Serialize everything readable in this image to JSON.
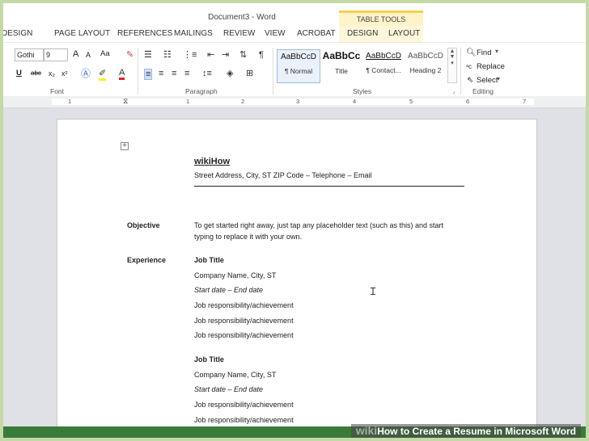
{
  "window": {
    "doc_title": "Document3 - Word",
    "contextual_group": "TABLE TOOLS"
  },
  "tabs": [
    "DESIGN",
    "PAGE LAYOUT",
    "REFERENCES",
    "MAILINGS",
    "REVIEW",
    "VIEW",
    "ACROBAT",
    "DESIGN",
    "LAYOUT"
  ],
  "ribbon": {
    "font": {
      "group_label": "Font",
      "font_name": "Gothi",
      "font_size": "9",
      "grow_label": "A",
      "shrink_label": "A",
      "case_label": "Aa",
      "underline_label": "U",
      "strike_label": "abc",
      "subscript_label": "x₂",
      "superscript_label": "x²"
    },
    "paragraph": {
      "group_label": "Paragraph"
    },
    "styles": {
      "group_label": "Styles",
      "items": [
        {
          "preview": "AaBbCcD",
          "name": "¶ Normal"
        },
        {
          "preview": "AaBbCc",
          "name": "Title"
        },
        {
          "preview": "AaBbCcD",
          "name": "¶ Contact..."
        },
        {
          "preview": "AaBbCcD",
          "name": "Heading 2"
        }
      ]
    },
    "editing": {
      "group_label": "Editing",
      "find": "Find",
      "replace": "Replace",
      "select": "Select"
    }
  },
  "ruler": {
    "numbers": [
      "1",
      "1",
      "2",
      "3",
      "4",
      "5",
      "6",
      "7"
    ]
  },
  "document": {
    "name": "wikiHow",
    "contact": "Street Address, City, ST ZIP Code – Telephone – Email",
    "objective_label": "Objective",
    "objective_line1": "To get started right away, just tap any placeholder text (such as this) and start",
    "objective_line2": "typing to replace it with your own.",
    "experience_label": "Experience",
    "jobs": [
      {
        "title": "Job Title",
        "company": "Company Name, City, ST",
        "dates": "Start date – End date",
        "resp1": "Job responsibility/achievement",
        "resp2": "Job responsibility/achievement",
        "resp3": "Job responsibility/achievement"
      },
      {
        "title": "Job Title",
        "company": "Company Name, City, ST",
        "dates": "Start date – End date",
        "resp1": "Job responsibility/achievement",
        "resp2": "Job responsibility/achievement"
      }
    ]
  },
  "watermark": {
    "brand": "wiki",
    "text": "How to Create a Resume in Microsoft Word"
  },
  "colors": {
    "border_green": "#c5d8a7",
    "table_tools_yellow": "#f4cf4f",
    "status_green": "#3a7b3a"
  }
}
